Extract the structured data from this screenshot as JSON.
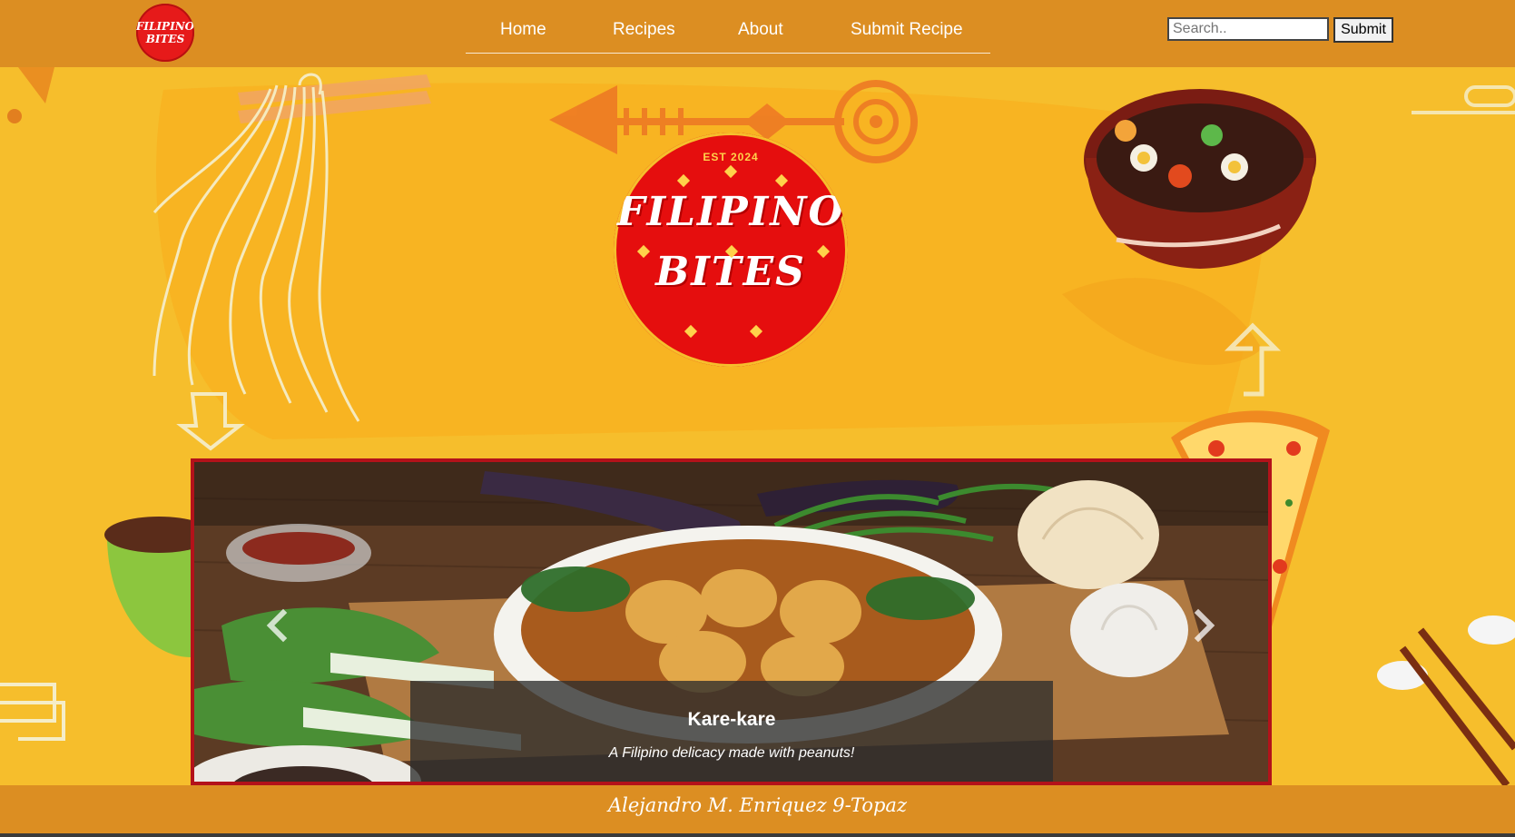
{
  "header": {
    "small_logo_line1": "FILIPINO",
    "small_logo_line2": "BITES",
    "nav": {
      "home": "Home",
      "recipes": "Recipes",
      "about": "About",
      "submit_recipe": "Submit Recipe"
    },
    "search": {
      "placeholder": "Search..",
      "value": ""
    },
    "submit_label": "Submit"
  },
  "hero_logo": {
    "est": "EST 2024",
    "line1": "FILIPINO",
    "line2": "BITES"
  },
  "carousel": {
    "caption_title": "Kare-kare",
    "caption_text": "A Filipino delicacy made with peanuts!"
  },
  "footer": {
    "text": "Alejandro M. Enriquez 9-Topaz"
  },
  "colors": {
    "header_bg": "#DC8E22",
    "page_bg": "#F6BE2C",
    "logo_red": "#E50E0E",
    "carousel_border": "#B3121A"
  },
  "icons": {
    "prev": "chevron-left-icon",
    "next": "chevron-right-icon"
  }
}
